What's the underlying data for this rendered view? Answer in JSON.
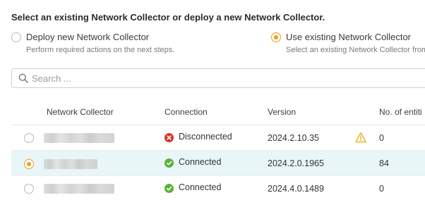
{
  "heading": "Select an existing Network Collector or deploy a new Network Collector.",
  "options": [
    {
      "label": "Deploy new Network Collector",
      "description": "Perform required actions on the next steps.",
      "selected": false
    },
    {
      "label": "Use existing Network Collector",
      "description": "Select an existing Network Collector from",
      "selected": true
    }
  ],
  "search": {
    "placeholder": "Search ..."
  },
  "table": {
    "columns": [
      "Network Collector",
      "Connection",
      "Version",
      "No. of entiti"
    ],
    "rows": [
      {
        "selected": false,
        "name_redacted": true,
        "connection": "Disconnected",
        "status": "error",
        "version": "2024.2.10.35",
        "warning": true,
        "entities": "0"
      },
      {
        "selected": true,
        "name_redacted": true,
        "connection": "Connected",
        "status": "ok",
        "version": "2024.2.0.1965",
        "warning": false,
        "entities": "84"
      },
      {
        "selected": false,
        "name_redacted": true,
        "connection": "Connected",
        "status": "ok",
        "version": "2024.4.0.1489",
        "warning": false,
        "entities": "0"
      }
    ]
  },
  "colors": {
    "accent": "#f39a1e",
    "selected_row": "#e9f6f8",
    "error": "#d9342b",
    "ok": "#5cb13a",
    "warning": "#f0b323"
  }
}
